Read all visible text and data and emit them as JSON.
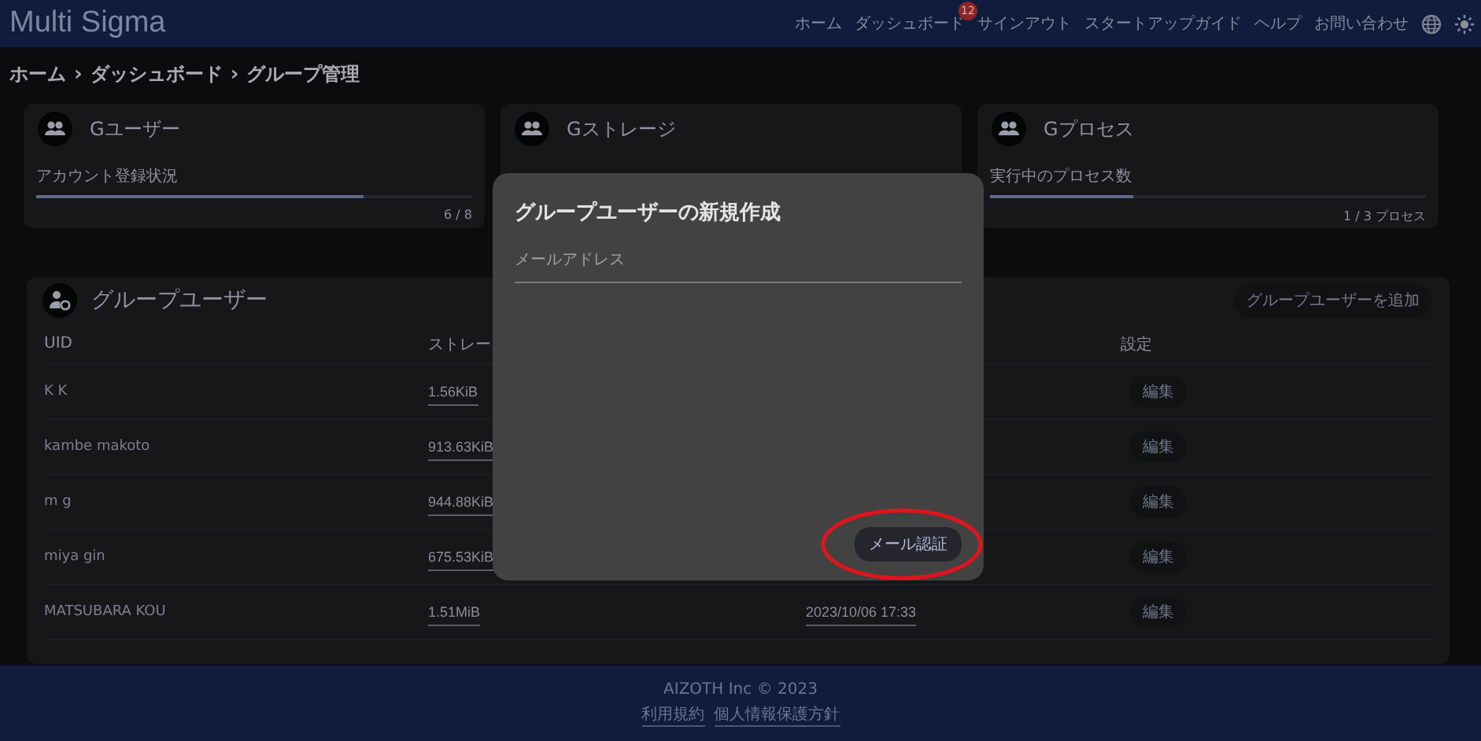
{
  "header": {
    "brand": "Multi Sigma",
    "nav": [
      {
        "label": "ホーム"
      },
      {
        "label": "ダッシュボード",
        "badge": "12"
      },
      {
        "label": "サインアウト"
      },
      {
        "label": "スタートアップガイド"
      },
      {
        "label": "ヘルプ"
      },
      {
        "label": "お問い合わせ"
      }
    ]
  },
  "breadcrumb": [
    "ホーム",
    "›",
    "ダッシュボード",
    "›",
    "グループ管理"
  ],
  "stat_cards": [
    {
      "title": "Gユーザー",
      "label": "アカウント登録状況",
      "level": 0.75,
      "reading": "6 / 8"
    },
    {
      "title": "Gストレージ"
    },
    {
      "title": "Gプロセス",
      "label": "実行中のプロセス数",
      "level": 0.33,
      "reading": "1 / 3 プロセス"
    }
  ],
  "table": {
    "title": "グループユーザー",
    "add_button": "グループユーザーを追加",
    "columns": [
      "UID",
      "ストレー",
      "設定"
    ],
    "rows": [
      {
        "uid": "K K",
        "storage": "1.56KiB",
        "action": "編集"
      },
      {
        "uid": "kambe makoto",
        "storage": "913.63KiB",
        "action": "編集"
      },
      {
        "uid": "m g",
        "storage": "944.88KiB",
        "action": "編集"
      },
      {
        "uid": "miya gin",
        "storage": "675.53KiB",
        "action": "編集"
      },
      {
        "uid": "MATSUBARA KOU",
        "storage": "1.51MiB",
        "date": "2023/10/06 17:33",
        "action": "編集"
      }
    ]
  },
  "dialog": {
    "title": "グループユーザーの新規作成",
    "email": {
      "placeholder": "メールアドレス"
    },
    "button": "メール認証",
    "highlighted": true
  },
  "footer": {
    "copyright": "AIZOTH Inc © 2023",
    "links": [
      "利用規約",
      "個人情報保護方針"
    ]
  }
}
